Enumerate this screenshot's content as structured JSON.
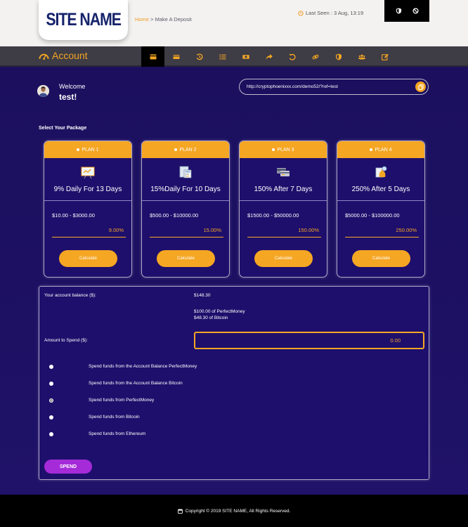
{
  "header": {
    "logo": "SITE NAME",
    "breadcrumb": {
      "home": "Home",
      "separator": " > ",
      "current": "Make A Deposit"
    },
    "last_seen": "Last Seen : 3 Aug, 13:19",
    "icons": [
      "shield-icon",
      "ban-icon"
    ]
  },
  "nav": {
    "title": "Account",
    "icons": [
      "wallet-icon",
      "credit-card-icon",
      "history-icon",
      "list-icon",
      "money-icon",
      "share-icon",
      "undo-icon",
      "link-icon",
      "shield-icon",
      "users-icon",
      "edit-icon"
    ],
    "active_index": 0
  },
  "welcome": {
    "label": "Welcome",
    "username": "test!"
  },
  "referral": {
    "url": "http://cryptophoenixxx.com/demo52/?ref=test"
  },
  "packages": {
    "title": "Select Your Package",
    "plans": [
      {
        "name": "PLAN 1",
        "title": "9% Daily For 13 Days",
        "range": "$10.00 - $3000.00",
        "rate": "9.00%",
        "button": "Calculate"
      },
      {
        "name": "PLAN 2",
        "title": "15%Daily For 10 Days",
        "range": "$500.00 - $10000.00",
        "rate": "15.00%",
        "button": "Calculate"
      },
      {
        "name": "PLAN 3",
        "title": "150% After 7 Days",
        "range": "$1500.00 - $50000.00",
        "rate": "150.00%",
        "button": "Calculate"
      },
      {
        "name": "PLAN 4",
        "title": "250% After 5 Days",
        "range": "$5000.00 - $100000.00",
        "rate": "250.00%",
        "button": "Calculate"
      }
    ]
  },
  "form": {
    "balance_label": "Your account balance ($):",
    "balance_value": "$148.30",
    "balance_breakdown": [
      "$100.00 of PerfectMoney",
      "$48.30 of Bitcoin"
    ],
    "amount_label": "Amount to Spend ($):",
    "amount_value": "0.00",
    "options": [
      "Spend funds from the Account Balance PerfectMoney",
      "Spend funds from the Account Balance Bitcoin",
      "Spend funds from PerfectMoney",
      "Spend funds from Bitcoin",
      "Spend funds from Ethereum"
    ],
    "selected_option": 2,
    "submit": "SPEND"
  },
  "footer": {
    "copyright": "Copyright © 2019 SITE NAME, All Rights Reserved."
  },
  "colors": {
    "accent": "#f5a623",
    "background": "#1b0f5c",
    "nav": "#3e3c45",
    "spend": "#a52bd9"
  }
}
